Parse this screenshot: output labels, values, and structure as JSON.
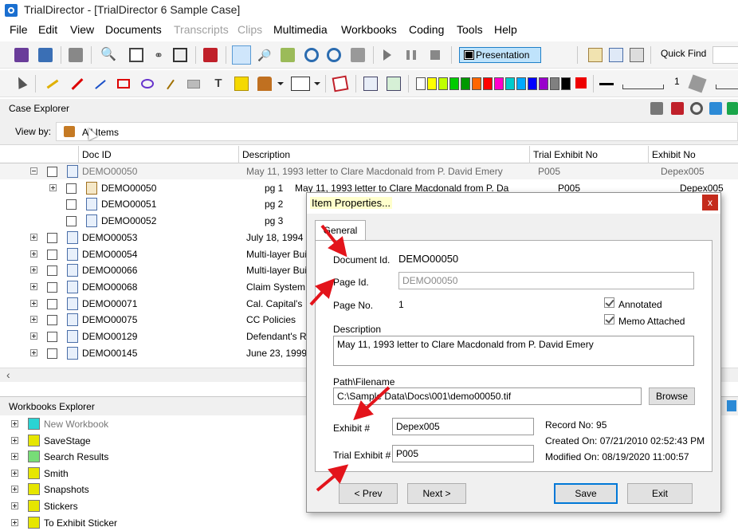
{
  "window": {
    "title": "TrialDirector - [TrialDirector 6 Sample Case]"
  },
  "menu": [
    {
      "label": "File",
      "disabled": false
    },
    {
      "label": "Edit",
      "disabled": false
    },
    {
      "label": "View",
      "disabled": false
    },
    {
      "label": "Documents",
      "disabled": false
    },
    {
      "label": "Transcripts",
      "disabled": true
    },
    {
      "label": "Clips",
      "disabled": true
    },
    {
      "label": "Multimedia",
      "disabled": false
    },
    {
      "label": "Workbooks",
      "disabled": false
    },
    {
      "label": "Coding",
      "disabled": false
    },
    {
      "label": "Tools",
      "disabled": false
    },
    {
      "label": "Help",
      "disabled": false
    }
  ],
  "toolbar": {
    "presentation_label": "Presentation",
    "quick_find_label": "Quick Find",
    "line_width_value": "1",
    "palette": [
      "#ffffff",
      "#ffff00",
      "#c0ff00",
      "#00cc00",
      "#009900",
      "#ff6600",
      "#ff0000",
      "#ff00cc",
      "#00cccc",
      "#00aaff",
      "#0000ff",
      "#9900cc",
      "#808080",
      "#000000"
    ],
    "active_color": "#ee0000"
  },
  "case_explorer": {
    "title": "Case Explorer",
    "view_by_label": "View by:",
    "view_by_value": "All Items",
    "columns": [
      "Doc ID",
      "Description",
      "Trial Exhibit No",
      "Exhibit No"
    ],
    "rows": [
      {
        "id": "DEMO00050",
        "desc": "May 11, 1993 letter to Clare Macdonald from P. David Emery",
        "trial": "P005",
        "exhibit": "Depex005",
        "level": 0,
        "selected": true
      },
      {
        "id": "DEMO00050",
        "page": "pg 1",
        "desc": "May 11, 1993 letter to Clare Macdonald from P. Da",
        "trial": "P005",
        "exhibit": "Depex005",
        "level": 1
      },
      {
        "id": "DEMO00051",
        "page": "pg 2",
        "desc": "",
        "trial": "",
        "exhibit": "",
        "level": 1
      },
      {
        "id": "DEMO00052",
        "page": "pg 3",
        "desc": "",
        "trial": "",
        "exhibit": "",
        "level": 1
      },
      {
        "id": "DEMO00053",
        "desc": "July 18, 1994",
        "level": 0
      },
      {
        "id": "DEMO00054",
        "desc": "Multi-layer Bui",
        "level": 0
      },
      {
        "id": "DEMO00066",
        "desc": "Multi-layer Bui",
        "level": 0
      },
      {
        "id": "DEMO00068",
        "desc": "Claim System",
        "level": 0
      },
      {
        "id": "DEMO00071",
        "desc": "Cal. Capital's",
        "level": 0
      },
      {
        "id": "DEMO00075",
        "desc": "CC Policies",
        "level": 0
      },
      {
        "id": "DEMO00129",
        "desc": "Defendant's R",
        "level": 0
      },
      {
        "id": "DEMO00145",
        "desc": "June 23, 1999",
        "level": 0
      }
    ]
  },
  "workbooks_explorer": {
    "title": "Workbooks Explorer",
    "items": [
      {
        "label": "New Workbook",
        "color": "#2ad4d4",
        "dim": true
      },
      {
        "label": "SaveStage",
        "color": "#e6e600"
      },
      {
        "label": "Search Results",
        "color": "#77dd77"
      },
      {
        "label": "Smith",
        "color": "#e6e600"
      },
      {
        "label": "Snapshots",
        "color": "#e6e600"
      },
      {
        "label": "Stickers",
        "color": "#e6e600"
      },
      {
        "label": "To Exhibit Sticker",
        "color": "#e6e600"
      }
    ]
  },
  "dialog": {
    "title": "Item Properties...",
    "close_glyph": "x",
    "tab": "General",
    "document_id_label": "Document Id.",
    "document_id_value": "DEMO00050",
    "page_id_label": "Page Id.",
    "page_id_value": "DEMO00050",
    "page_no_label": "Page No.",
    "page_no_value": "1",
    "annotated_label": "Annotated",
    "annotated_checked": true,
    "memo_label": "Memo Attached",
    "memo_checked": true,
    "description_label": "Description",
    "description_value": "May 11, 1993 letter to Clare Macdonald from P. David Emery",
    "path_label": "Path\\Filename",
    "path_value": "C:\\Sample Data\\Docs\\001\\demo00050.tif",
    "browse_label": "Browse",
    "exhibit_label": "Exhibit #",
    "exhibit_value": "Depex005",
    "trial_exhibit_label": "Trial Exhibit #",
    "trial_exhibit_value": "P005",
    "record_no": "Record No: 95",
    "created_on": "Created On: 07/21/2010 02:52:43 PM",
    "modified_on": "Modified On: 08/19/2020 11:00:57",
    "prev_label": "< Prev",
    "next_label": "Next >",
    "save_label": "Save",
    "exit_label": "Exit"
  }
}
